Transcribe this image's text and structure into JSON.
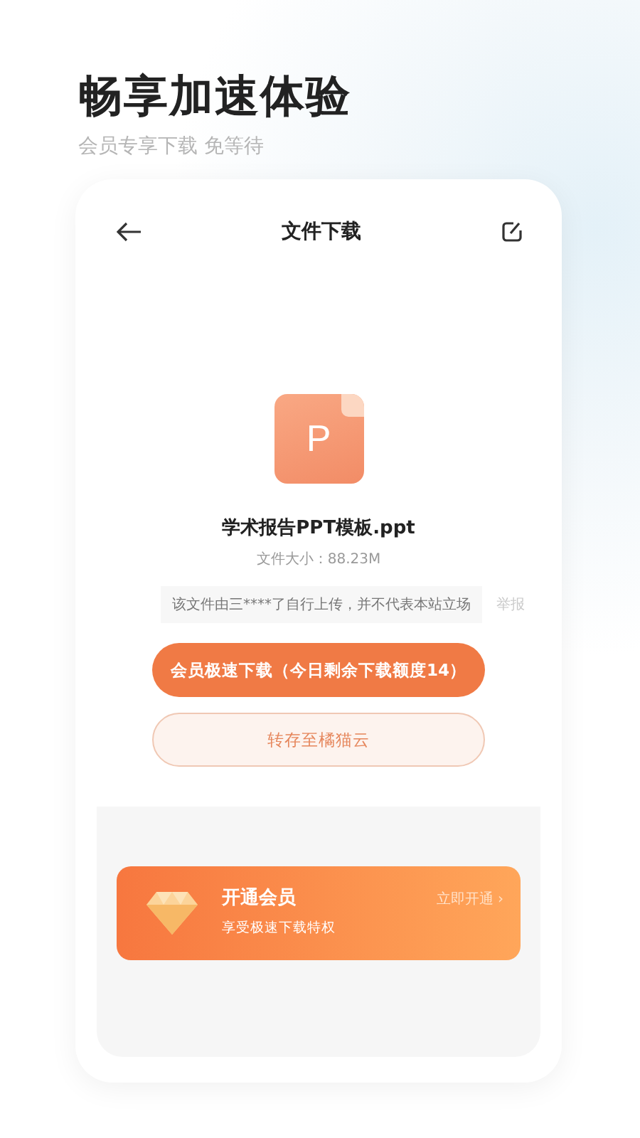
{
  "headline": {
    "title": "畅享加速体验",
    "subtitle": "会员专享下载 免等待"
  },
  "screen": {
    "title": "文件下载",
    "file": {
      "icon_letter": "P",
      "name": "学术报告PPT模板.ppt",
      "size": "文件大小：88.23M"
    },
    "notice": {
      "text": "该文件由三****了自行上传，并不代表本站立场",
      "link": "举报"
    },
    "buttons": [
      {
        "kind": "primary",
        "label": "会员极速下载（今日剩余下载额度14）"
      },
      {
        "kind": "secondary",
        "label": "转存至橘猫云"
      }
    ],
    "banner": {
      "title": "开通会员",
      "subtitle": "享受极速下载特权",
      "action": "立即开通",
      "action_icon": "›"
    }
  }
}
